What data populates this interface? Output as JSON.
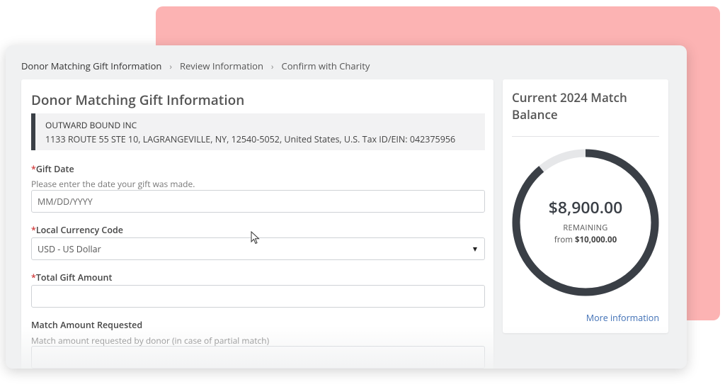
{
  "breadcrumb": {
    "items": [
      {
        "label": "Donor Matching Gift Information",
        "active": true
      },
      {
        "label": "Review Information",
        "active": false
      },
      {
        "label": "Confirm with Charity",
        "active": false
      }
    ],
    "separator": ">"
  },
  "form": {
    "title": "Donor Matching Gift Information",
    "organization": {
      "name": "OUTWARD BOUND INC",
      "address": "1133 ROUTE 55 STE 10, LAGRANGEVILLE, NY, 12540-5052, United States, U.S. Tax ID/EIN: 042375956"
    },
    "required_mark": "*",
    "gift_date": {
      "label": "Gift Date",
      "help": "Please enter the date your gift was made.",
      "placeholder": "MM/DD/YYYY",
      "value": ""
    },
    "currency": {
      "label": "Local Currency Code",
      "selected": "USD - US Dollar"
    },
    "total_amount": {
      "label": "Total Gift Amount",
      "value": ""
    },
    "match_amount": {
      "label": "Match Amount Requested",
      "help": "Match amount requested by donor (in case of partial match)",
      "value": ""
    }
  },
  "balance": {
    "title": "Current 2024 Match Balance",
    "remaining_amount": "$8,900.00",
    "remaining_label": "REMAINING",
    "from_prefix": "from",
    "total_amount": "$10,000.00",
    "remaining_fraction": 0.89,
    "link": "More information"
  },
  "colors": {
    "backdrop": "#fcb3b3",
    "donut_fill": "#3a3f46",
    "donut_track": "#e6e7e9",
    "link": "#3f6fb5",
    "required": "#d03c3c"
  },
  "icons": {
    "breadcrumb_separator": "chevron-right-icon",
    "select_caret": "caret-down-icon",
    "cursor": "mouse-pointer-icon"
  }
}
